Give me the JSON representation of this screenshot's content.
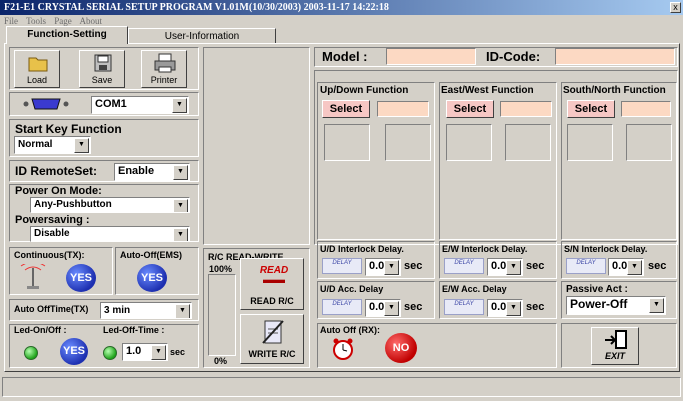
{
  "window": {
    "title": "F21-E1 CRYSTAL SERIAL SETUP PROGRAM V1.01M(10/30/2003)  2003-11-17  14:22:18",
    "close": "x"
  },
  "menu": [
    "File",
    "Tools",
    "Page",
    "About"
  ],
  "tabs": [
    "Function-Setting",
    "User-Information"
  ],
  "toolbar": {
    "load": "Load",
    "save": "Save",
    "printer": "Printer"
  },
  "com_port": "COM1",
  "start_key": {
    "label": "Start Key Function",
    "value": "Normal"
  },
  "id_remote": {
    "label": "ID RemoteSet:",
    "value": "Enable"
  },
  "power_on": {
    "label": "Power On Mode:",
    "value": "Any-Pushbutton"
  },
  "power_saving": {
    "label": "Powersaving :",
    "value": "Disable"
  },
  "continuous": {
    "label": "Continuous(TX):",
    "button": "YES"
  },
  "auto_off_ems": {
    "label": "Auto-Off(EMS)",
    "button": "YES"
  },
  "auto_off_time": {
    "label": "Auto OffTime(TX)",
    "value": "3   min"
  },
  "led_on_off": {
    "label": "Led-On/Off :",
    "button": "YES"
  },
  "led_off_time": {
    "label": "Led-Off-Time :",
    "value": "1.0",
    "unit": "sec"
  },
  "rc_rw": {
    "title": "R/C READ-WRITE",
    "pct_top": "100%",
    "pct_bottom": "0%",
    "read_icon_text": "READ",
    "read": "READ  R/C",
    "write": "WRITE R/C"
  },
  "model": {
    "label": "Model :",
    "value": ""
  },
  "id_code": {
    "label": "ID-Code:",
    "value": ""
  },
  "functions": [
    {
      "title": "Up/Down Function",
      "select": "Select",
      "value": ""
    },
    {
      "title": "East/West Function",
      "select": "Select",
      "value": ""
    },
    {
      "title": "South/North Function",
      "select": "Select",
      "value": ""
    }
  ],
  "interlock": [
    {
      "label": "U/D Interlock Delay.",
      "value": "0.0",
      "unit": "sec"
    },
    {
      "label": "E/W Interlock Delay.",
      "value": "0.0",
      "unit": "sec"
    },
    {
      "label": "S/N Interlock Delay.",
      "value": "0.0",
      "unit": "sec"
    }
  ],
  "acc_delay": [
    {
      "label": "U/D Acc. Delay",
      "value": "0.0",
      "unit": "sec"
    },
    {
      "label": "E/W Acc. Delay",
      "value": "0.0",
      "unit": "sec"
    }
  ],
  "delay_image_text": "DELAY",
  "passive": {
    "label": "Passive Act :",
    "value": "Power-Off"
  },
  "auto_off_rx": {
    "label": "Auto Off (RX):",
    "button": "NO"
  },
  "exit": "EXIT",
  "colors": {
    "pink_field": "#fcd9c3",
    "select_button": "#f6c7c4",
    "face": "#d4d0c8",
    "yes_blue": "#1d2fb0",
    "no_red": "#c00000"
  }
}
